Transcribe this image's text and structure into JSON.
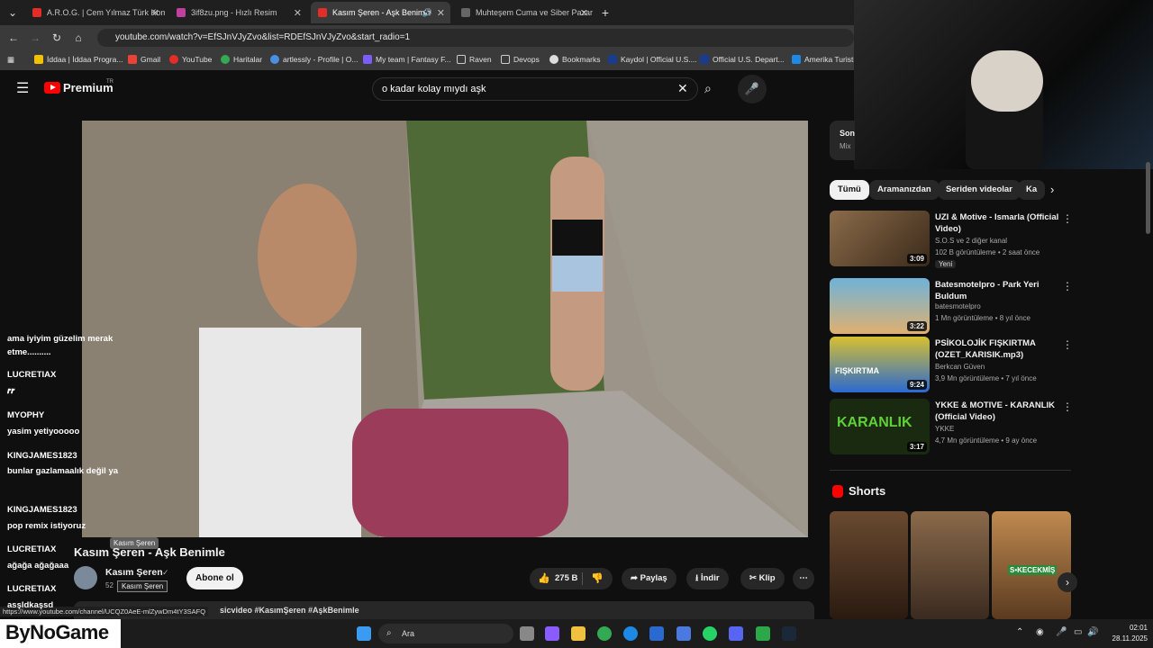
{
  "tabs": [
    {
      "label": "A.R.O.G. | Cem Yılmaz Türk Kom",
      "close": "✕"
    },
    {
      "label": "3if8zu.png - Hızlı Resim",
      "close": "✕"
    },
    {
      "label": "Kasım Şeren - Aşk Benimle",
      "close": "✕",
      "audio": "🔊"
    },
    {
      "label": "Muhteşem Cuma ve Siber Pazar",
      "close": "✕"
    }
  ],
  "new_tab": "+",
  "url": "youtube.com/watch?v=EfSJnVJyZvo&list=RDEfSJnVJyZvo&start_radio=1",
  "bookmarks": [
    "İddaa | İddaa Progra...",
    "Gmail",
    "YouTube",
    "Haritalar",
    "artlessly - Profile | O...",
    "My team | Fantasy F...",
    "Raven",
    "Devops",
    "Bookmarks",
    "Kaydol | Official U.S....",
    "Official U.S. Depart...",
    "Amerika Turisti"
  ],
  "yt": {
    "logo": "Premium",
    "logo_sup": "TR",
    "search_value": "o kadar kolay mıydı aşk"
  },
  "sidebar": {
    "mix_title": "Son",
    "mix_sub": "Mix",
    "chips": [
      "Tümü",
      "Aramanızdan",
      "Seriden videolar",
      "Ka"
    ],
    "recs": [
      {
        "title": "UZI & Motive - Ismarla (Official Video)",
        "channel": "S.O.S ve 2 diğer kanal",
        "meta": "102 B görüntüleme • 2 saat önce",
        "badge": "Yeni",
        "duration": "3:09"
      },
      {
        "title": "Batesmotelpro - Park Yeri Buldum",
        "channel": "batesmotelpro",
        "meta": "1 Mn görüntüleme • 8 yıl önce",
        "duration": "3:22"
      },
      {
        "title": "PSİKOLOJİK FIŞKIRTMA (OZET_KARISIK.mp3)",
        "channel": "Berkcan Güven",
        "meta": "3,9 Mn görüntüleme • 7 yıl önce",
        "duration": "9:24",
        "thumb_text": "FIŞKIRTMA"
      },
      {
        "title": "YKKE & MOTIVE - KARANLIK (Official Video)",
        "channel": "YKKE",
        "meta": "4,7 Mn görüntüleme • 9 ay önce",
        "duration": "3:17",
        "thumb_text": "KARANLIK"
      }
    ],
    "shorts_title": "Shorts",
    "shorts_thumb_text": "S•KECEKMİŞ"
  },
  "video": {
    "title": "Kasım Şeren - Aşk Benimle",
    "tooltip_top": "Kasım Şeren",
    "channel": "Kasım Şeren",
    "channel_tooltip": "Kasım Şeren",
    "subs": "52",
    "subscribe": "Abone ol",
    "likes": "275 B",
    "share": "Paylaş",
    "download": "İndir",
    "clip": "Klip",
    "description": "sicvideo #KasımŞeren #AşkBenimle",
    "status_url": "https://www.youtube.com/channel/UCQZ0AeE-mlZywDm4tY3SAFQ"
  },
  "chat": [
    {
      "user": "",
      "msg": "ama iyiyim güzelim merak etme.........."
    },
    {
      "user": "LUCRETIAX",
      "msg": "𝒓𝒓"
    },
    {
      "user": "MYOPHY",
      "msg": "yasim yetiyooooo"
    },
    {
      "user": "KINGJAMES1823",
      "msg": "bunlar gazlamaalık değil ya"
    },
    {
      "user": "KINGJAMES1823",
      "msg": "pop remix istiyoruz"
    },
    {
      "user": "LUCRETIAX",
      "msg": "ağağa ağağaaa"
    },
    {
      "user": "LUCRETIAX",
      "msg": "asşldkaşsd"
    }
  ],
  "watermark": "ByNoGame",
  "taskbar": {
    "search": "Ara",
    "time": "02:01",
    "date": "28.11.2025"
  }
}
